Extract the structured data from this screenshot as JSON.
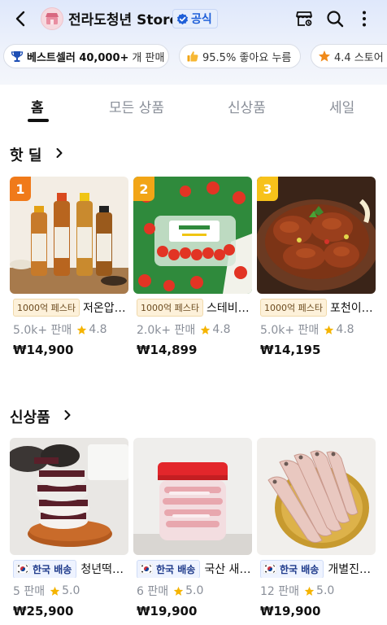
{
  "header": {
    "store_name": "전라도청년 Store",
    "official_label": "공식"
  },
  "chips": [
    {
      "icon": "trophy-icon",
      "strong": "베스트셀러 40,000+",
      "text": "개 판매"
    },
    {
      "icon": "thumbs-up-icon",
      "strong": "",
      "text": "95.5% 좋아요 누름"
    },
    {
      "icon": "star-icon",
      "strong": "",
      "text": "4.4 스토어"
    }
  ],
  "tabs": [
    "홈",
    "모든 상품",
    "신상품",
    "세일"
  ],
  "active_tab": "홈",
  "sections": {
    "hot_deal": {
      "title": "핫 딜",
      "products": [
        {
          "rank": "1",
          "rank_color": "#f07a1a",
          "badge": "1000억 페스타",
          "title": "저온압착 참기름",
          "sales": "5.0k+ 판매",
          "rating": "4.8",
          "price": "₩14,900"
        },
        {
          "rank": "2",
          "rank_color": "#f2a516",
          "badge": "1000억 페스타",
          "title": "스테비아 토마토",
          "sales": "2.0k+ 판매",
          "rating": "4.8",
          "price": "₩14,899"
        },
        {
          "rank": "3",
          "rank_color": "#f7c21a",
          "badge": "1000억 페스타",
          "title": "포천이동갈비",
          "sales": "5.0k+ 판매",
          "rating": "4.8",
          "price": "₩14,195"
        }
      ]
    },
    "new_items": {
      "title": "신상품",
      "products": [
        {
          "badge": "한국 배송",
          "title": "청년떡집 찹쌀떡",
          "sales": "5 판매",
          "rating": "5.0",
          "price": "₩25,900"
        },
        {
          "badge": "한국 배송",
          "title": "국산 새우젓",
          "sales": "6 판매",
          "rating": "5.0",
          "price": "₩19,900"
        },
        {
          "badge": "한국 배송",
          "title": "개별진공 반건조 생선",
          "sales": "12 판매",
          "rating": "5.0",
          "price": "₩19,900"
        }
      ]
    }
  },
  "colors": {
    "accent_blue": "#1e5fd8",
    "star": "#f5b400",
    "fest_badge_bg": "#fdf1da"
  }
}
